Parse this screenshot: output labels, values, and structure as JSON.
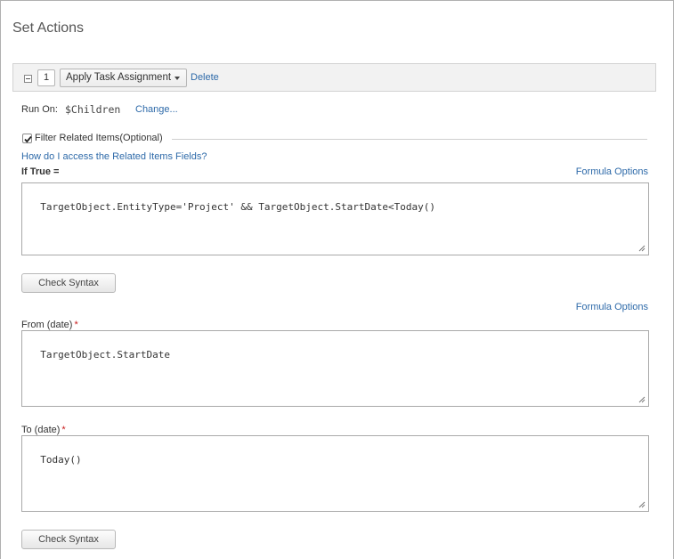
{
  "page": {
    "title": "Set Actions"
  },
  "action_bar": {
    "index": "1",
    "action_select": "Apply Task Assignment",
    "delete_label": "Delete"
  },
  "run_on": {
    "label": "Run On:",
    "value": "$Children",
    "change_label": "Change..."
  },
  "filter": {
    "checked": true,
    "label": "Filter Related Items(Optional)",
    "help_link": "How do I access the Related Items Fields?"
  },
  "if_true": {
    "label": "If True =",
    "formula_options": "Formula Options",
    "expression": "TargetObject.EntityType='Project' && TargetObject.StartDate<Today()",
    "check_syntax": "Check Syntax"
  },
  "dates": {
    "formula_options": "Formula Options",
    "from_label": "From (date)",
    "from_value": "TargetObject.StartDate",
    "to_label": "To (date)",
    "to_value": "Today()",
    "required_mark": "*",
    "check_syntax": "Check Syntax"
  },
  "colors": {
    "link": "#2e6aa9",
    "required": "#c81e1e"
  }
}
